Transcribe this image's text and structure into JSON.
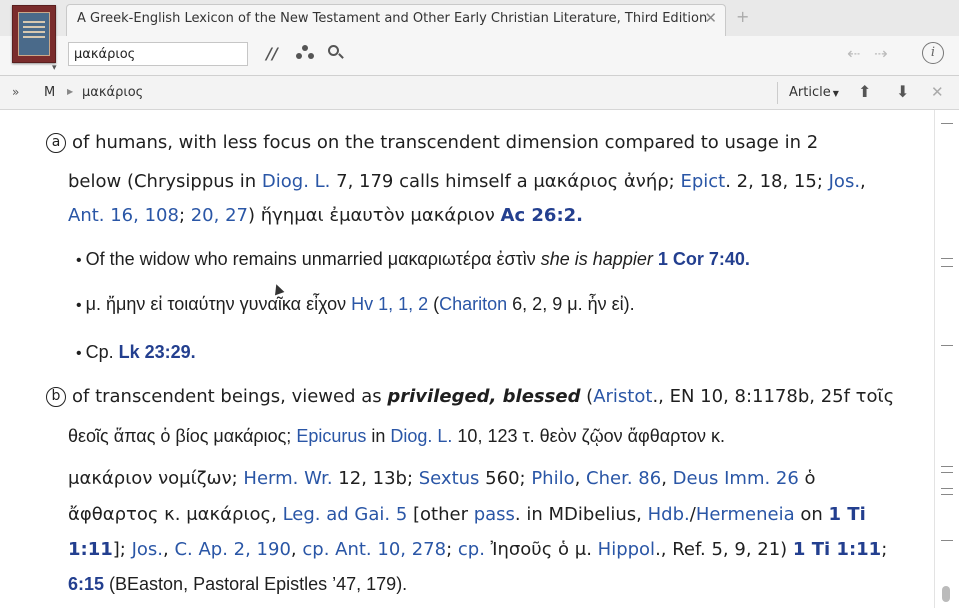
{
  "tab": {
    "title": "A Greek-English Lexicon of the New Testament and Other Early Christian Literature, Third Edition",
    "close": "✕",
    "add": "+"
  },
  "toolbar": {
    "search_value": "μακάριος",
    "parallel_icon": "//",
    "back": "⇠",
    "forward": "⇢",
    "info": "i"
  },
  "breadcrumb": {
    "expand": "»",
    "letter": "M",
    "separator": "▶",
    "word": "μακάριος",
    "article_label": "Article",
    "up": "⬆",
    "down": "⬇",
    "close": "✕"
  },
  "icons": {
    "book_cover": "book-cover-icon",
    "parallel": "parallel-resources-icon",
    "visual_filter": "visual-filter-icon",
    "search": "search-icon",
    "back": "back-arrow-icon",
    "forward": "forward-arrow-icon",
    "info": "info-icon"
  },
  "entry": {
    "a": {
      "marker": "a",
      "l1_text": "of humans, with less focus on the transcendent dimension compared to usage in 2",
      "l2_pre": "below (Chrysippus in ",
      "l2_link1": "Diog. L.",
      "l2_mid1": " 7, 179 calls himself a μακάριος ἀνήρ; ",
      "l2_link2": "Epict",
      "l2_mid2": ". 2, 18, 15; ",
      "l2_link3": "Jos.",
      "l2_end": ",",
      "l3_link1": "Ant. 16, 108",
      "l3_sep": "; ",
      "l3_link2": "20, 27",
      "l3_mid": ") ἥγημαι ἐμαυτὸν μακάριον ",
      "l3_ref": "Ac 26:2.",
      "b1_text": "Of the widow who remains unmarried μακαριωτέρα ἐστὶν ",
      "b1_ital": "she is happier",
      "b1_ref": "1 Cor 7:40.",
      "b2_text": "μ. ἤμην εἰ τοιαύτην γυναῖκα εἶχον ",
      "b2_link1": "Hv 1, 1, 2",
      "b2_mid": " (",
      "b2_link2": "Chariton",
      "b2_end": " 6, 2, 9 μ. ἦν εἰ).",
      "b3_text": "Cp. ",
      "b3_ref": "Lk 23:29."
    },
    "b": {
      "marker": "b",
      "l1_pre": "of transcendent beings, viewed as ",
      "l1_bold": "privileged, blessed",
      "l1_mid": " (",
      "l1_link": "Aristot",
      "l1_end": "., EN 10, 8:1178b, 25f τοῖς",
      "l2_pre": "θεοῖς ἅπας ὁ βίος μακάριος; ",
      "l2_link1": "Epicurus",
      "l2_mid": " in ",
      "l2_link2": "Diog. L.",
      "l2_end": " 10, 123 τ. θεὸν ζῷον ἄφθαρτον κ.",
      "l3_pre": "μακάριον νομίζων; ",
      "l3_link1": "Herm. Wr.",
      "l3_mid1": " 12, 13b; ",
      "l3_link2": "Sextus",
      "l3_mid2": " 560; ",
      "l3_link3": "Philo",
      "l3_mid3": ", ",
      "l3_link4": "Cher. 86",
      "l3_mid4": ", ",
      "l3_link5": "Deus Imm. 26",
      "l3_end": " ὁ",
      "l4_pre": "ἄφθαρτος κ. μακάριος, ",
      "l4_link1": "Leg. ad Gai. 5",
      "l4_mid1": " [other ",
      "l4_link2": "pass",
      "l4_mid2": ". in MDibelius, ",
      "l4_link3": "Hdb.",
      "l4_slash": "/",
      "l4_link4": "Hermeneia",
      "l4_mid3": " on ",
      "l4_ref": "1 Ti",
      "l5_ref1": "1:11",
      "l5_mid1": "]; ",
      "l5_link1": "Jos.",
      "l5_mid2": ", ",
      "l5_link2": "C. Ap. 2, 190",
      "l5_mid3": ", ",
      "l5_link3": "cp. Ant. 10, 278",
      "l5_mid4": "; ",
      "l5_link4": "cp.",
      "l5_mid5": " Ἰησοῦς ὁ μ. ",
      "l5_link5": "Hippol",
      "l5_mid6": "., Ref. 5, 9, 21) ",
      "l5_ref2": "1 Ti 1:11",
      "l5_end": ";",
      "l6_ref": "6:15",
      "l6_end": " (BEaston, Pastoral Epistles ’47, 179)."
    }
  }
}
